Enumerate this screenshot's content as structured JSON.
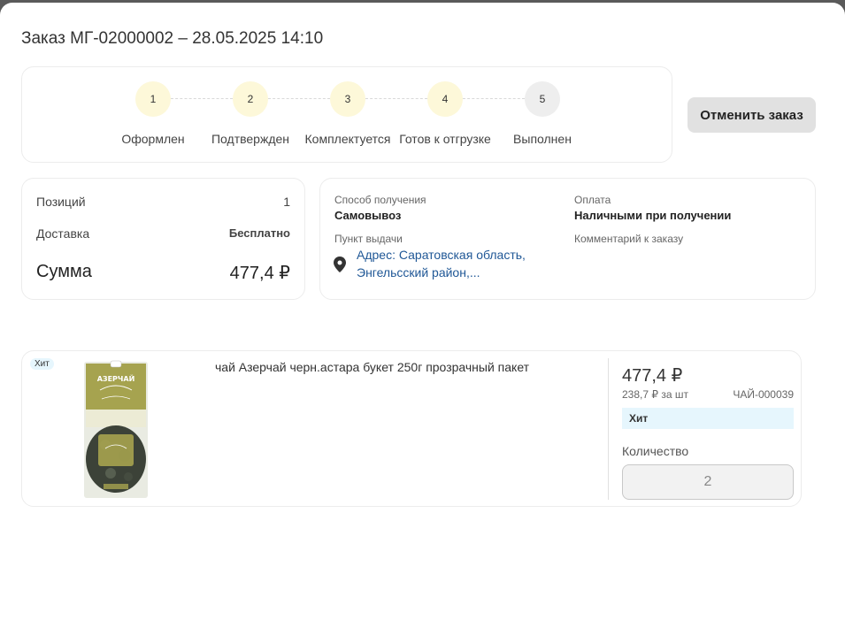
{
  "order": {
    "title": "Заказ МГ-02000002 – 28.05.2025 14:10",
    "cancel_label": "Отменить заказ"
  },
  "steps": [
    {
      "number": "1",
      "label": "Оформлен",
      "done": true
    },
    {
      "number": "2",
      "label": "Подтвержден",
      "done": true
    },
    {
      "number": "3",
      "label": "Комплектуется",
      "done": true
    },
    {
      "number": "4",
      "label": "Готов к отгрузке",
      "done": true
    },
    {
      "number": "5",
      "label": "Выполнен",
      "done": false
    }
  ],
  "summary": {
    "positions_label": "Позиций",
    "positions_value": "1",
    "delivery_label": "Доставка",
    "delivery_value": "Бесплатно",
    "total_label": "Сумма",
    "total_value": "477,4 ₽"
  },
  "delivery": {
    "method_label": "Способ получения",
    "method_value": "Самовывоз",
    "payment_label": "Оплата",
    "payment_value": "Наличными при получении",
    "pickup_label": "Пункт выдачи",
    "address": "Адрес: Саратовская область, Энгельсский район,...",
    "comment_label": "Комментарий к заказу"
  },
  "product": {
    "badge": "Хит",
    "name": "чай Азерчай черн.астара букет 250г прозрачный пакет",
    "price": "477,4 ₽",
    "unit_price": "238,7 ₽ за шт",
    "sku": "ЧАЙ-000039",
    "tag": "Хит",
    "quantity_label": "Количество",
    "quantity_value": "2",
    "image_brand": "АЗЕРЧАЙ"
  },
  "colors": {
    "step_done": "#fdf8d9",
    "step_pending": "#eeeeee",
    "badge_bg": "#e6f6fd",
    "link": "#1f5796"
  }
}
